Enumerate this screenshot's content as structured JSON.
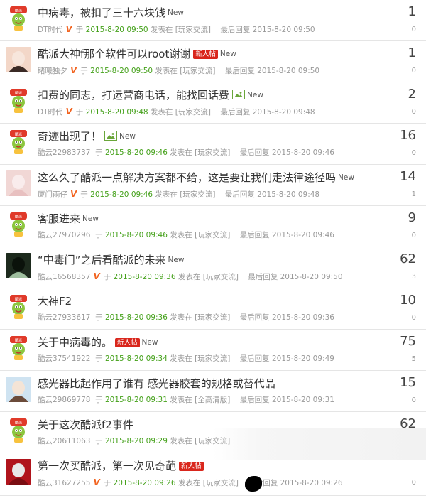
{
  "colors": {
    "accent_green": "#45a11b",
    "badge_red": "#d9261c",
    "v_orange": "#f26522"
  },
  "labels": {
    "new": "New",
    "newbie_badge": "新人帖",
    "posted_prefix": "于",
    "posted_in": "发表在",
    "last_reply": "最后回复",
    "v_icon": "V"
  },
  "posts": [
    {
      "avatar": "mascot-icon",
      "title": "中病毒，被扣了三十六块钱",
      "new": true,
      "newbie": false,
      "image": false,
      "author": "DT时代",
      "verified": true,
      "date": "2015-8-20 09:50",
      "forum": "[玩家交流]",
      "last_reply": "2015-8-20 09:50",
      "replies": "1",
      "views": "0"
    },
    {
      "avatar": "girl-photo",
      "title": "酷派大神f那个软件可以root谢谢",
      "new": true,
      "newbie": true,
      "image": false,
      "author": "睹曦独夕",
      "verified": true,
      "date": "2015-8-20 09:50",
      "forum": "[玩家交流]",
      "last_reply": "2015-8-20 09:50",
      "replies": "1",
      "views": "0"
    },
    {
      "avatar": "mascot-icon",
      "title": "扣费的同志，打运营商电话，能找回话费",
      "new": true,
      "newbie": false,
      "image": true,
      "author": "DT时代",
      "verified": true,
      "date": "2015-8-20 09:48",
      "forum": "[玩家交流]",
      "last_reply": "2015-8-20 09:48",
      "replies": "2",
      "views": "0"
    },
    {
      "avatar": "mascot-icon",
      "title": "奇迹出现了！",
      "new": true,
      "newbie": false,
      "image": true,
      "author": "酷云22983737",
      "verified": false,
      "date": "2015-8-20 09:46",
      "forum": "[玩家交流]",
      "last_reply": "2015-8-20 09:46",
      "replies": "16",
      "views": "0"
    },
    {
      "avatar": "pink-photo",
      "title": "这么久了酷派一点解决方案都不给，这是要让我们走法律途径吗",
      "new": true,
      "newbie": false,
      "image": false,
      "author": "厦门雨仔",
      "verified": true,
      "date": "2015-8-20 09:46",
      "forum": "[玩家交流]",
      "last_reply": "2015-8-20 09:48",
      "replies": "14",
      "views": "1"
    },
    {
      "avatar": "mascot-icon",
      "title": "客服进来",
      "new": true,
      "newbie": false,
      "image": false,
      "author": "酷云27970296",
      "verified": false,
      "date": "2015-8-20 09:46",
      "forum": "[玩家交流]",
      "last_reply": "2015-8-20 09:46",
      "replies": "9",
      "views": "0"
    },
    {
      "avatar": "umbrella-photo",
      "title": "“中毒门”之后看酷派的未来",
      "new": true,
      "newbie": false,
      "image": false,
      "author": "酷云16568357",
      "verified": true,
      "date": "2015-8-20 09:36",
      "forum": "[玩家交流]",
      "last_reply": "2015-8-20 09:50",
      "replies": "62",
      "views": "3"
    },
    {
      "avatar": "mascot-icon",
      "title": "大神F2",
      "new": false,
      "newbie": false,
      "image": false,
      "author": "酷云27933617",
      "verified": false,
      "date": "2015-8-20 09:36",
      "forum": "[玩家交流]",
      "last_reply": "2015-8-20 09:36",
      "replies": "10",
      "views": "0"
    },
    {
      "avatar": "mascot-icon",
      "title": "关于中病毒的。",
      "new": true,
      "newbie": true,
      "image": false,
      "author": "酷云37541922",
      "verified": false,
      "date": "2015-8-20 09:34",
      "forum": "[玩家交流]",
      "last_reply": "2015-8-20 09:49",
      "replies": "75",
      "views": "5"
    },
    {
      "avatar": "woman-photo",
      "title": "感光器比起作用了谁有 感光器胶套的规格或替代品",
      "new": false,
      "newbie": false,
      "image": false,
      "author": "酷云29869778",
      "verified": false,
      "date": "2015-8-20 09:31",
      "forum": "[全高清版]",
      "last_reply": "2015-8-20 09:31",
      "replies": "15",
      "views": "0"
    },
    {
      "avatar": "mascot-icon",
      "title": "关于这次酷派f2事件",
      "new": false,
      "newbie": false,
      "image": false,
      "author": "酷云20611063",
      "verified": false,
      "date": "2015-8-20 09:29",
      "forum": "[玩家交流]",
      "last_reply": "",
      "replies": "62",
      "views": ""
    },
    {
      "avatar": "rose-photo",
      "title": "第一次买酷派，第一次见奇葩",
      "new": false,
      "newbie": true,
      "image": false,
      "author": "酷云31627255",
      "verified": true,
      "date": "2015-8-20 09:26",
      "forum": "[玩家交流]",
      "last_reply": "2015-8-20 09:26",
      "replies": "",
      "views": "0"
    }
  ]
}
